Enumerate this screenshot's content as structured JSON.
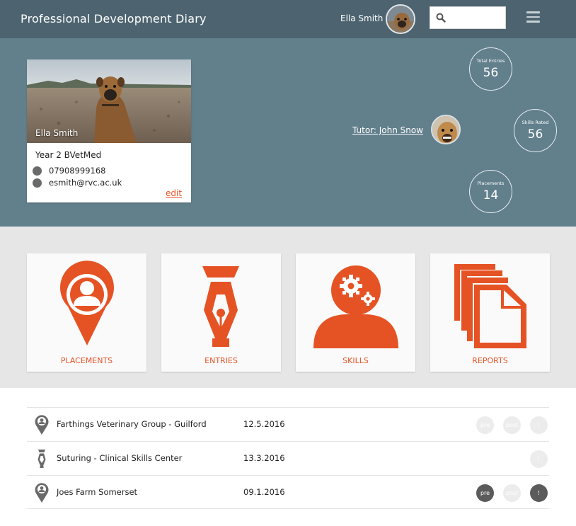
{
  "header": {
    "title": "Professional Development Diary",
    "user_name": "Ella Smith",
    "search_placeholder": "",
    "icons": {
      "search": "search-icon",
      "menu": "hamburger-menu-icon"
    },
    "color": "#4d6470"
  },
  "profile": {
    "name": "Ella Smith",
    "year": "Year 2 BVetMed",
    "phone": "07908999168",
    "email": "esmith@rvc.ac.uk",
    "edit_label": "edit",
    "tutor": "Tutor: John Snow"
  },
  "stats": {
    "total_entries": {
      "label": "Total Entries",
      "value": "56"
    },
    "skills_rated": {
      "label": "Skills Rated",
      "value": "56"
    },
    "placements": {
      "label": "Placements",
      "value": "14"
    }
  },
  "tiles": {
    "placements": "PLACEMENTS",
    "entries": "ENTRIES",
    "skills": "SKILLS",
    "reports": "REPORTS",
    "accent": "#e55325"
  },
  "list": [
    {
      "icon": "location-pin-icon",
      "name": "Farthings Veterinary Group - Guilford",
      "date": "12.5.2016",
      "pre": "pre",
      "mid": "post",
      "end": "!",
      "pre_active": false,
      "mid_active": false,
      "end_active": false
    },
    {
      "icon": "pen-nib-icon",
      "name": "Suturing - Clinical Skills Center",
      "date": "13.3.2016",
      "end": "!",
      "end_active": false
    },
    {
      "icon": "location-pin-icon",
      "name": "Joes Farm Somerset",
      "date": "09.1.2016",
      "pre": "pre",
      "mid": "post",
      "end": "!",
      "pre_active": true,
      "mid_active": false,
      "end_active": true
    }
  ]
}
